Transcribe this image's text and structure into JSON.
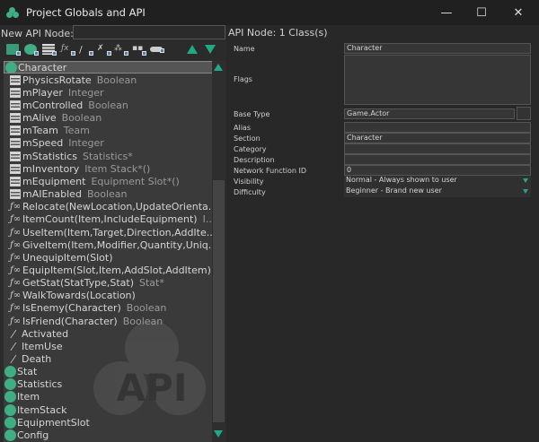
{
  "window": {
    "title": "Project Globals and API",
    "minimize": "—",
    "maximize": "☐",
    "close": "✕"
  },
  "new_node": {
    "label": "New API Node:",
    "value": ""
  },
  "toolbar": [
    "add-class",
    "add-object",
    "add-variable",
    "add-function",
    "add-event",
    "add-operator",
    "add-hierarchy",
    "add-tree",
    "add-enum"
  ],
  "tree": {
    "items": [
      {
        "kind": "cls",
        "name": "Character",
        "type": "",
        "selected": true
      },
      {
        "kind": "var",
        "name": "PhysicsRotate",
        "type": "Boolean"
      },
      {
        "kind": "var",
        "name": "mPlayer",
        "type": "Integer"
      },
      {
        "kind": "var",
        "name": "mControlled",
        "type": "Boolean"
      },
      {
        "kind": "var",
        "name": "mAlive",
        "type": "Boolean"
      },
      {
        "kind": "var",
        "name": "mTeam",
        "type": "Team"
      },
      {
        "kind": "var",
        "name": "mSpeed",
        "type": "Integer"
      },
      {
        "kind": "var",
        "name": "mStatistics",
        "type": "Statistics*"
      },
      {
        "kind": "var",
        "name": "mInventory",
        "type": "Item Stack*()"
      },
      {
        "kind": "var",
        "name": "mEquipment",
        "type": "Equipment Slot*()"
      },
      {
        "kind": "var",
        "name": "mAIEnabled",
        "type": "Boolean"
      },
      {
        "kind": "fn",
        "name": "Relocate(NewLocation,UpdateOrienta...",
        "type": ""
      },
      {
        "kind": "fn",
        "name": "ItemCount(Item,IncludeEquipment)",
        "type": "I..."
      },
      {
        "kind": "fn",
        "name": "UseItem(Item,Target,Direction,AddIte...",
        "type": ""
      },
      {
        "kind": "fn",
        "name": "GiveItem(Item,Modifier,Quantity,Uniq...",
        "type": ""
      },
      {
        "kind": "fn",
        "name": "UnequipItem(Slot)",
        "type": ""
      },
      {
        "kind": "fn",
        "name": "EquipItem(Slot,Item,AddSlot,AddItem)",
        "type": ""
      },
      {
        "kind": "fn",
        "name": "GetStat(StatType,Stat)",
        "type": "Stat*"
      },
      {
        "kind": "fn",
        "name": "WalkTowards(Location)",
        "type": ""
      },
      {
        "kind": "fn",
        "name": "IsEnemy(Character)",
        "type": "Boolean"
      },
      {
        "kind": "fn",
        "name": "IsFriend(Character)",
        "type": "Boolean"
      },
      {
        "kind": "ev",
        "name": "Activated",
        "type": ""
      },
      {
        "kind": "ev",
        "name": "ItemUse",
        "type": ""
      },
      {
        "kind": "ev",
        "name": "Death",
        "type": ""
      },
      {
        "kind": "cls",
        "name": "Stat",
        "type": ""
      },
      {
        "kind": "cls",
        "name": "Statistics",
        "type": ""
      },
      {
        "kind": "cls",
        "name": "Item",
        "type": ""
      },
      {
        "kind": "cls",
        "name": "ItemStack",
        "type": ""
      },
      {
        "kind": "cls",
        "name": "EquipmentSlot",
        "type": ""
      },
      {
        "kind": "cls",
        "name": "Config",
        "type": ""
      }
    ]
  },
  "watermark": "API",
  "details": {
    "header": "API Node: 1 Class(s)",
    "name_label": "Name",
    "name": "Character",
    "flags_label": "Flags",
    "base_type_label": "Base Type",
    "base_type": "Game.Actor",
    "alias_label": "Alias",
    "alias": "",
    "section_label": "Section",
    "section": "Character",
    "category_label": "Category",
    "category": "",
    "description_label": "Description",
    "description": "",
    "netid_label": "Network Function ID",
    "netid": "0",
    "visibility_label": "Visibility",
    "visibility": "Normal - Always shown to user",
    "difficulty_label": "Difficulty",
    "difficulty": "Beginner - Brand new user"
  },
  "colors": {
    "accent": "#22a884",
    "class": "#3fae83"
  }
}
